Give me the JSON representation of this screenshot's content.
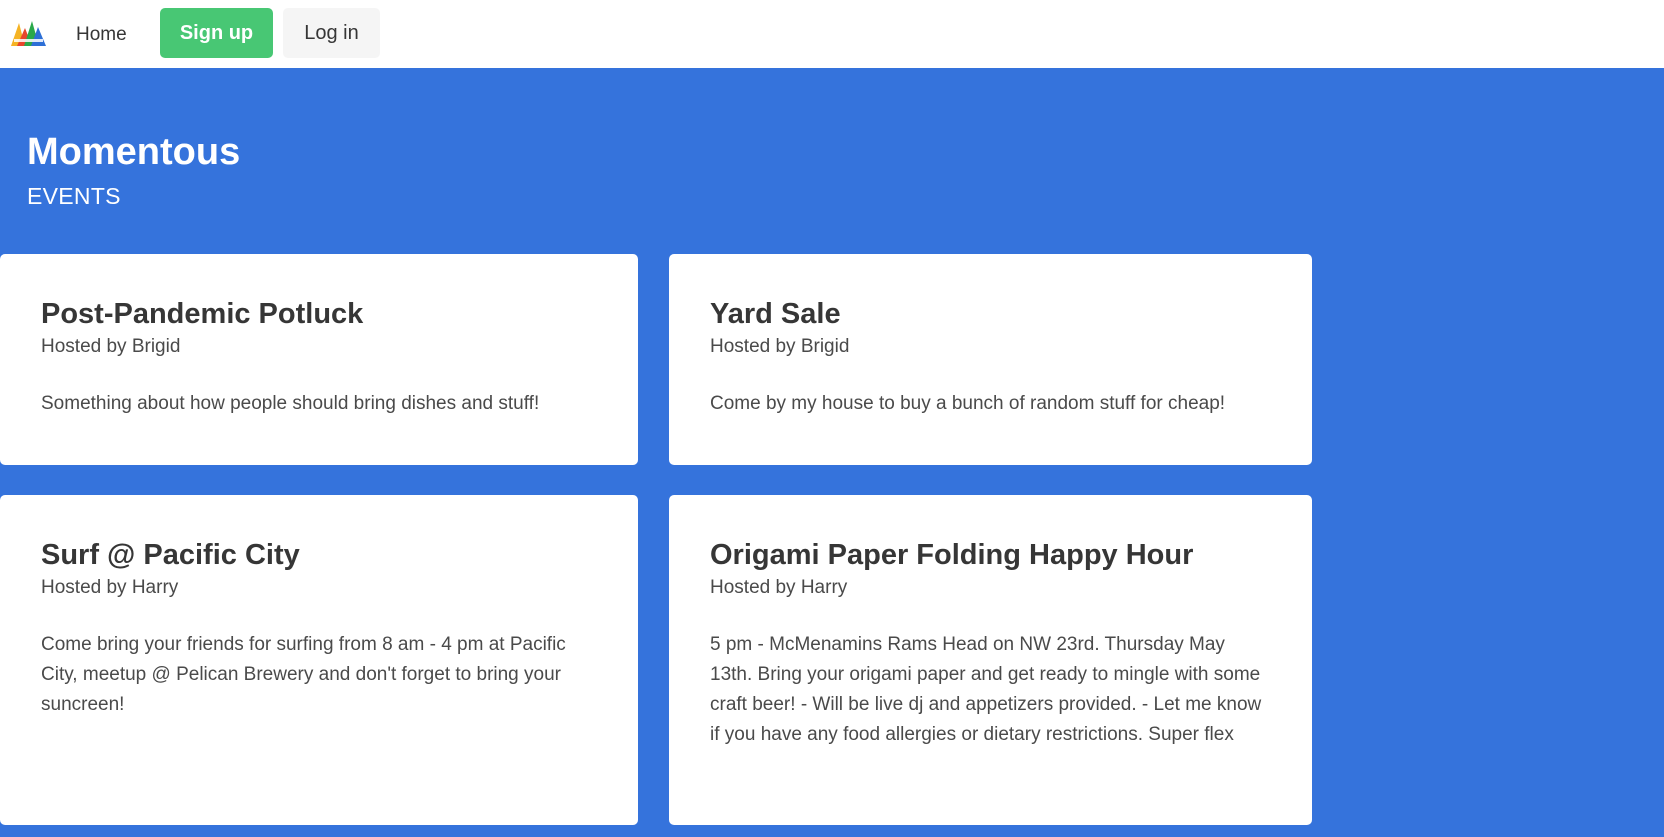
{
  "nav": {
    "logo_icon": "momentous-logo-icon",
    "home_label": "Home",
    "signup_label": "Sign up",
    "login_label": "Log in"
  },
  "hero": {
    "title": "Momentous",
    "subtitle": "EVENTS"
  },
  "events": [
    {
      "title": "Post-Pandemic Potluck",
      "host": "Hosted by Brigid",
      "description": "Something about how people should bring dishes and stuff!"
    },
    {
      "title": "Yard Sale",
      "host": "Hosted by Brigid",
      "description": "Come by my house to buy a bunch of random stuff for cheap!"
    },
    {
      "title": "Surf @ Pacific City",
      "host": "Hosted by Harry",
      "description": "Come bring your friends for surfing from 8 am - 4 pm at Pacific City, meetup @ Pelican Brewery and don't forget to bring your suncreen!"
    },
    {
      "title": "Origami Paper Folding Happy Hour",
      "host": "Hosted by Harry",
      "description": "5 pm - McMenamins Rams Head on NW 23rd. Thursday May 13th. Bring your origami paper and get ready to mingle with some craft beer! - Will be live dj and appetizers provided. - Let me know if you have any food allergies or dietary restrictions. Super flex"
    }
  ],
  "colors": {
    "hero_background": "#3573dc",
    "signup_button": "#48c774",
    "login_button": "#f5f5f5",
    "card_background": "#ffffff"
  }
}
